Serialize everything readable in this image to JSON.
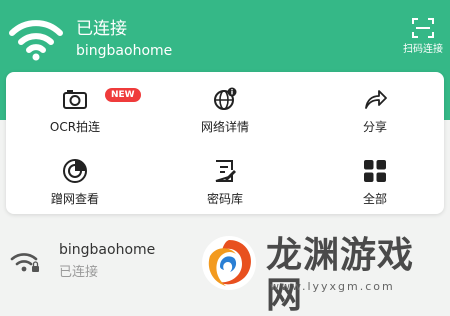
{
  "header": {
    "status": "已连接",
    "ssid": "bingbaohome",
    "scan_label": "扫码连接"
  },
  "tools": [
    {
      "label": "OCR拍连",
      "icon": "camera-icon",
      "badge": "NEW"
    },
    {
      "label": "网络详情",
      "icon": "globe-info-icon"
    },
    {
      "label": "分享",
      "icon": "share-arrow-icon"
    },
    {
      "label": "蹭网查看",
      "icon": "radar-icon"
    },
    {
      "label": "密码库",
      "icon": "notepad-icon"
    },
    {
      "label": "全部",
      "icon": "grid-icon"
    }
  ],
  "network": {
    "name": "bingbaohome",
    "status": "已连接"
  },
  "watermark": {
    "text": "龙渊游戏网",
    "url": "www.lyyxgm.com"
  },
  "colors": {
    "header_green": "#35b887",
    "badge_red": "#ef3b3b"
  }
}
